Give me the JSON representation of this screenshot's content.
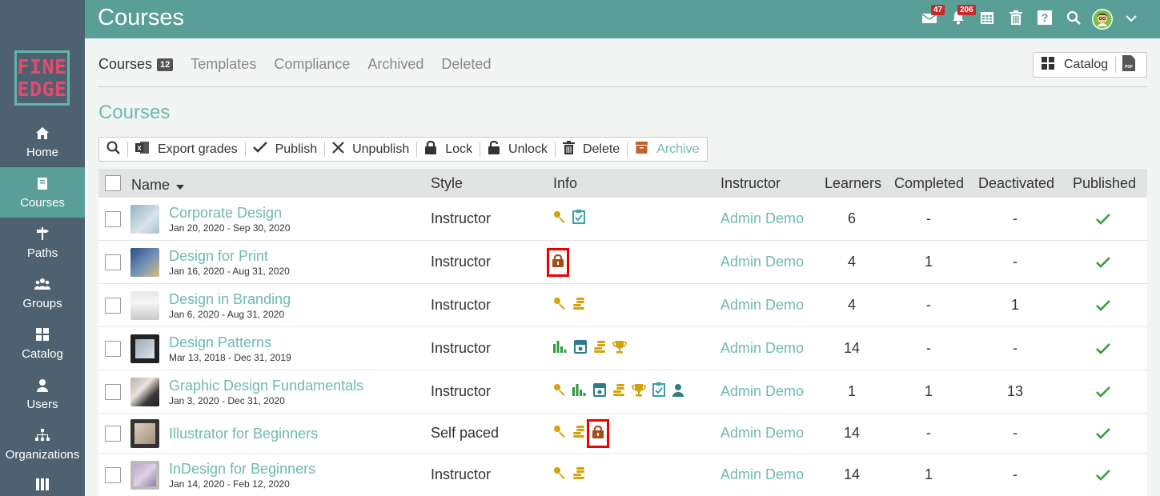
{
  "app": {
    "title": "Courses"
  },
  "logo": {
    "line1": "FINE",
    "line2": "EDGE"
  },
  "top_icons": [
    {
      "name": "messages-icon",
      "badge": "47"
    },
    {
      "name": "notifications-icon",
      "badge": "206"
    },
    {
      "name": "calendar-icon"
    },
    {
      "name": "trash-icon"
    },
    {
      "name": "help-icon"
    },
    {
      "name": "search-icon"
    },
    {
      "name": "avatar"
    },
    {
      "name": "chevron-down-icon"
    }
  ],
  "sidebar": {
    "items": [
      {
        "label": "Home",
        "icon": "home-icon"
      },
      {
        "label": "Courses",
        "icon": "book-icon",
        "active": true
      },
      {
        "label": "Paths",
        "icon": "signpost-icon"
      },
      {
        "label": "Groups",
        "icon": "groups-icon"
      },
      {
        "label": "Catalog",
        "icon": "grid-icon"
      },
      {
        "label": "Users",
        "icon": "user-icon"
      },
      {
        "label": "Organizations",
        "icon": "org-icon"
      },
      {
        "label": "",
        "icon": "more-icon"
      }
    ]
  },
  "tabs": [
    {
      "label": "Courses",
      "count": "12",
      "active": true
    },
    {
      "label": "Templates"
    },
    {
      "label": "Compliance"
    },
    {
      "label": "Archived"
    },
    {
      "label": "Deleted"
    }
  ],
  "catalog_button": {
    "label": "Catalog"
  },
  "section_title": "Courses",
  "toolbar": {
    "export": "Export grades",
    "publish": "Publish",
    "unpublish": "Unpublish",
    "lock": "Lock",
    "unlock": "Unlock",
    "delete": "Delete",
    "archive": "Archive"
  },
  "table": {
    "headers": {
      "name": "Name",
      "style": "Style",
      "info": "Info",
      "instructor": "Instructor",
      "learners": "Learners",
      "completed": "Completed",
      "deactivated": "Deactivated",
      "published": "Published"
    },
    "rows": [
      {
        "title": "Corporate Design",
        "dates": "Jan 20, 2020 - Sep 30, 2020",
        "style": "Instructor",
        "info": [
          "key",
          "clipboard"
        ],
        "instructor": "Admin Demo",
        "learners": "6",
        "completed": "-",
        "deactivated": "-",
        "published": "✓"
      },
      {
        "title": "Design for Print",
        "dates": "Jan 16, 2020 - Aug 31, 2020",
        "style": "Instructor",
        "info": [
          "lock-hl"
        ],
        "instructor": "Admin Demo",
        "learners": "4",
        "completed": "1",
        "deactivated": "-",
        "published": "✓"
      },
      {
        "title": "Design in Branding",
        "dates": "Jan 6, 2020 - Aug 31, 2020",
        "style": "Instructor",
        "info": [
          "key",
          "coins"
        ],
        "instructor": "Admin Demo",
        "learners": "4",
        "completed": "-",
        "deactivated": "1",
        "published": "✓"
      },
      {
        "title": "Design Patterns",
        "dates": "Mar 13, 2018 - Dec 31, 2019",
        "style": "Instructor",
        "info": [
          "chart",
          "certificate",
          "coins",
          "trophy"
        ],
        "instructor": "Admin Demo",
        "learners": "14",
        "completed": "-",
        "deactivated": "-",
        "published": "✓"
      },
      {
        "title": "Graphic Design Fundamentals",
        "dates": "Jan 3, 2020 - Dec 31, 2020",
        "style": "Instructor",
        "info": [
          "key",
          "chart",
          "certificate",
          "coins",
          "trophy",
          "clipboard",
          "person"
        ],
        "instructor": "Admin Demo",
        "learners": "1",
        "completed": "1",
        "deactivated": "13",
        "published": "✓"
      },
      {
        "title": "Illustrator for Beginners",
        "dates": "",
        "style": "Self paced",
        "info": [
          "key",
          "coins",
          "lock-hl"
        ],
        "instructor": "Admin Demo",
        "learners": "14",
        "completed": "-",
        "deactivated": "-",
        "published": "✓"
      },
      {
        "title": "InDesign for Beginners",
        "dates": "Jan 14, 2020 - Feb 12, 2020",
        "style": "Instructor",
        "info": [
          "key",
          "coins"
        ],
        "instructor": "Admin Demo",
        "learners": "14",
        "completed": "1",
        "deactivated": "-",
        "published": "✓"
      }
    ]
  },
  "colors": {
    "teal": "#5a9f97",
    "sidebar": "#4e6170",
    "link": "#6dbab0",
    "gold": "#d4a20a",
    "green": "#2e9a3a",
    "check": "#3a9a3a"
  }
}
